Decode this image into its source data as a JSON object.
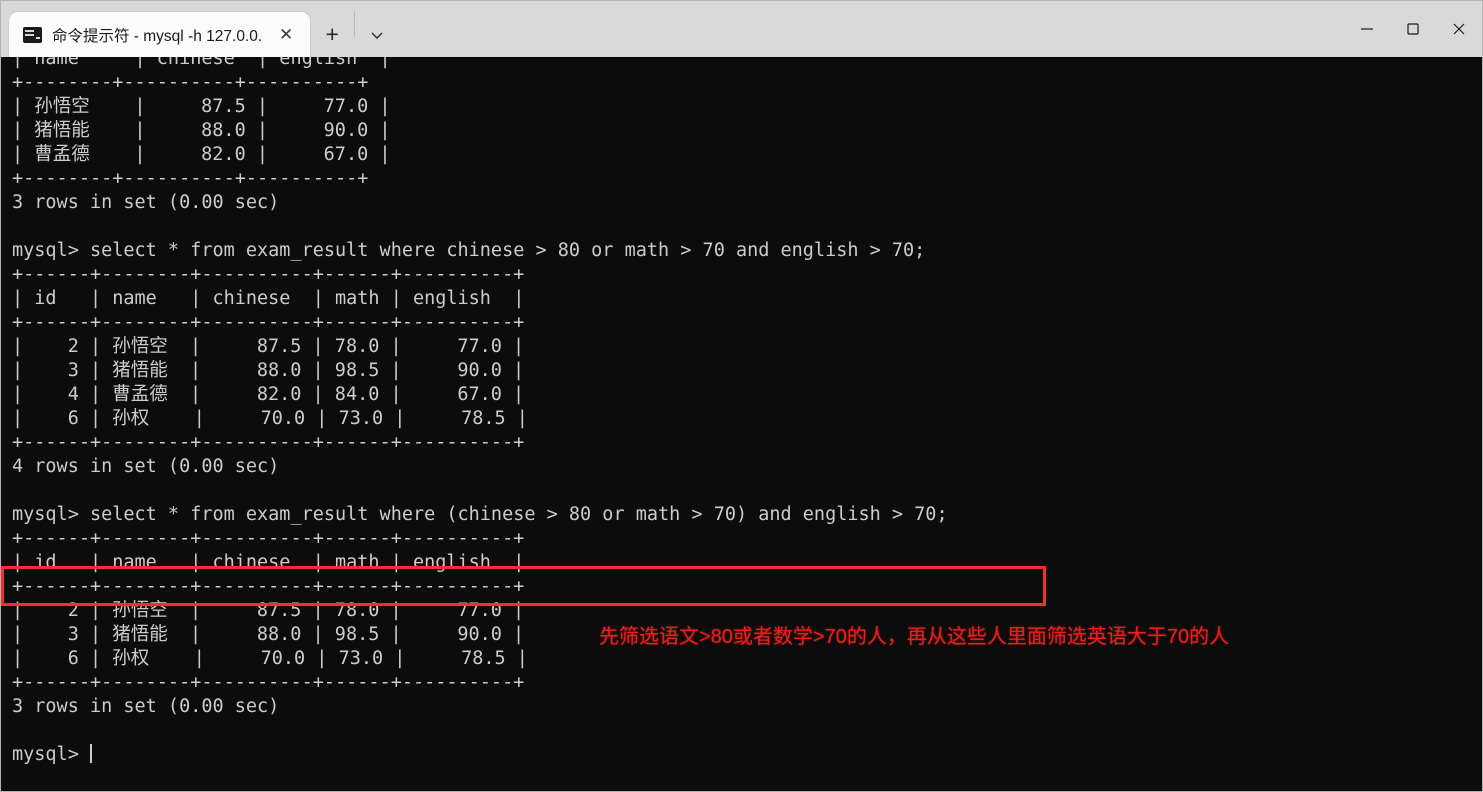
{
  "window": {
    "tab": {
      "title": "命令提示符 - mysql  -h 127.0.0.",
      "icon": "terminal-icon",
      "close_label": "✕"
    },
    "new_tab_label": "+",
    "dropdown_label": "⌄",
    "controls": {
      "minimize": "minimize-icon",
      "maximize": "maximize-icon",
      "close": "close-icon"
    },
    "titlebar_bg": "#d9d9d9",
    "terminal_bg": "#0c0c0c",
    "terminal_fg": "#cccccc"
  },
  "annotation": {
    "text": "先筛选语文>80或者数学>70的人，再从这些人里面筛选英语大于70的人",
    "color": "#ee1c1c"
  },
  "highlight": {
    "color": "#f03030",
    "target_line": "mysql> select * from exam_result where (chinese > 80 or math > 70) and english > 70;"
  },
  "terminal": {
    "lines": [
      "| name     | chinese  | english  |",
      "+--------+----------+----------+",
      "| 孙悟空    |     87.5 |     77.0 |",
      "| 猪悟能    |     88.0 |     90.0 |",
      "| 曹孟德    |     82.0 |     67.0 |",
      "+--------+----------+----------+",
      "3 rows in set (0.00 sec)",
      "",
      "mysql> select * from exam_result where chinese > 80 or math > 70 and english > 70;",
      "+------+--------+----------+------+----------+",
      "| id   | name   | chinese  | math | english  |",
      "+------+--------+----------+------+----------+",
      "|    2 | 孙悟空  |     87.5 | 78.0 |     77.0 |",
      "|    3 | 猪悟能  |     88.0 | 98.5 |     90.0 |",
      "|    4 | 曹孟德  |     82.0 | 84.0 |     67.0 |",
      "|    6 | 孙权    |     70.0 | 73.0 |     78.5 |",
      "+------+--------+----------+------+----------+",
      "4 rows in set (0.00 sec)",
      "",
      "mysql> select * from exam_result where (chinese > 80 or math > 70) and english > 70;",
      "+------+--------+----------+------+----------+",
      "| id   | name   | chinese  | math | english  |",
      "+------+--------+----------+------+----------+",
      "|    2 | 孙悟空  |     87.5 | 78.0 |     77.0 |",
      "|    3 | 猪悟能  |     88.0 | 98.5 |     90.0 |",
      "|    6 | 孙权    |     70.0 | 73.0 |     78.5 |",
      "+------+--------+----------+------+----------+",
      "3 rows in set (0.00 sec)",
      "",
      "mysql> "
    ],
    "prompt": "mysql> ",
    "queries": [
      "select * from exam_result where chinese > 80 or math > 70 and english > 70;",
      "select * from exam_result where (chinese > 80 or math > 70) and english > 70;"
    ],
    "results": [
      {
        "columns": [
          "name",
          "chinese",
          "english"
        ],
        "rows": [
          [
            "孙悟空",
            "87.5",
            "77.0"
          ],
          [
            "猪悟能",
            "88.0",
            "90.0"
          ],
          [
            "曹孟德",
            "82.0",
            "67.0"
          ]
        ],
        "status": "3 rows in set (0.00 sec)"
      },
      {
        "columns": [
          "id",
          "name",
          "chinese",
          "math",
          "english"
        ],
        "rows": [
          [
            "2",
            "孙悟空",
            "87.5",
            "78.0",
            "77.0"
          ],
          [
            "3",
            "猪悟能",
            "88.0",
            "98.5",
            "90.0"
          ],
          [
            "4",
            "曹孟德",
            "82.0",
            "84.0",
            "67.0"
          ],
          [
            "6",
            "孙权",
            "70.0",
            "73.0",
            "78.5"
          ]
        ],
        "status": "4 rows in set (0.00 sec)"
      },
      {
        "columns": [
          "id",
          "name",
          "chinese",
          "math",
          "english"
        ],
        "rows": [
          [
            "2",
            "孙悟空",
            "87.5",
            "78.0",
            "77.0"
          ],
          [
            "3",
            "猪悟能",
            "88.0",
            "98.5",
            "90.0"
          ],
          [
            "6",
            "孙权",
            "70.0",
            "73.0",
            "78.5"
          ]
        ],
        "status": "3 rows in set (0.00 sec)"
      }
    ]
  }
}
